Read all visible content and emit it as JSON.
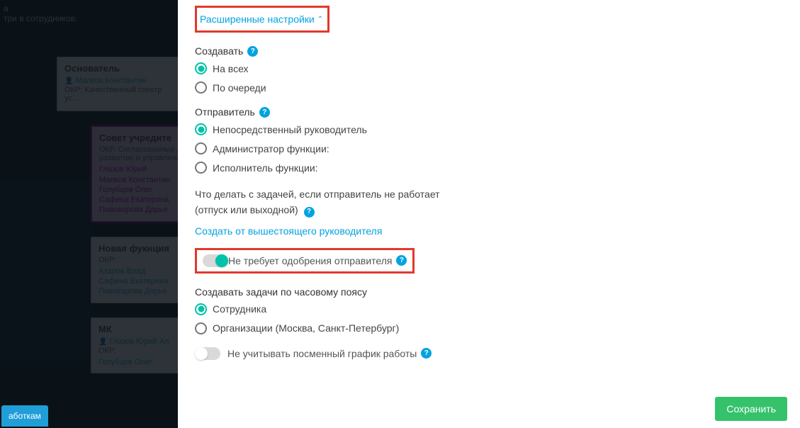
{
  "background": {
    "header_line1": "а",
    "header_line2": "три в сотрудников.",
    "root_card": {
      "title": "Основатель",
      "person": "Малков Константин",
      "okr": "ОКР: Качественный спектр ус..."
    },
    "card_sovet": {
      "title": "Совет учредите",
      "okr": "ОКР. Согласованные до\nразвитию и управлени",
      "names": "Глазов Юрий\nМалков Константин\nГолубцов Олег\nСафина Екатерина\nПивоварова Дарья"
    },
    "card_new": {
      "title": "Новая фукнция",
      "okr": "ОКР:",
      "names": "Азаров Влад\nСафина Екатерина\nПивоварова Дарья"
    },
    "card_mk": {
      "title": "МК",
      "person": "Глазов Юрий Ал",
      "okr": "ОКР:",
      "names": "Голубцов Олег"
    },
    "bottom_button": "аботкам"
  },
  "panel": {
    "advanced_toggle": "Расширенные настройки",
    "create": {
      "label": "Создавать",
      "opt_all": "На всех",
      "opt_turn": "По очереди"
    },
    "sender": {
      "label": "Отправитель",
      "opt_supervisor": "Непосредственный руководитель",
      "opt_admin": "Администратор функции:",
      "opt_executor": "Исполнитель функции:"
    },
    "absence": {
      "line1": "Что делать с задачей, если отправитель не работает",
      "line2": "(отпуск или выходной)",
      "link": "Создать от вышестоящего руководителя"
    },
    "no_approval_label": "Не требует одобрения отправителя",
    "timezone": {
      "label": "Создавать задачи по часовому поясу",
      "opt_employee": "Сотрудника",
      "opt_org": "Организации (Москва, Санкт-Петербург)"
    },
    "shift_label": "Не учитывать посменный график работы",
    "save": "Сохранить"
  }
}
